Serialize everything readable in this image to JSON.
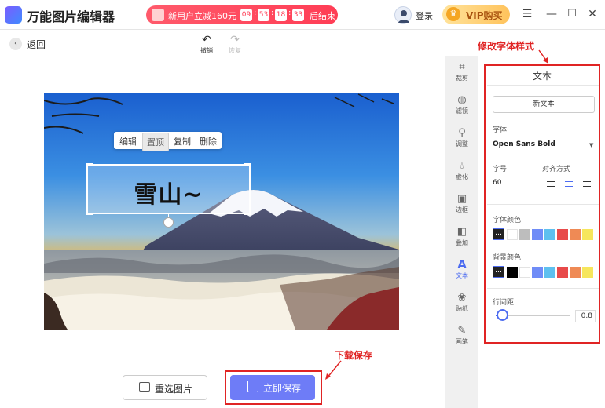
{
  "app": {
    "title": "万能图片编辑器"
  },
  "promo": {
    "text": "新用户立减160元",
    "timer": [
      "09",
      "53",
      "18",
      "33"
    ],
    "end_label": "后结束"
  },
  "header": {
    "login_label": "登录",
    "vip_label": "VIP购买",
    "crown_icon": "crown-icon",
    "menu_icon": "hamburger-icon",
    "minimize_icon": "minimize-icon",
    "maximize_icon": "maximize-icon",
    "close_icon": "close-icon"
  },
  "nav": {
    "back_label": "返回",
    "undo_label": "撤销",
    "redo_label": "恢复"
  },
  "context_menu": [
    "编辑",
    "置顶",
    "复制",
    "删除"
  ],
  "text_layer": {
    "content": "雪山~"
  },
  "buttons": {
    "reselect_label": "重选图片",
    "save_label": "立即保存"
  },
  "annotations": {
    "download_save": "下载保存",
    "modify_font_style": "修改字体样式"
  },
  "toolbar": [
    {
      "label": "裁剪",
      "icon": "crop-icon",
      "active": false
    },
    {
      "label": "滤镜",
      "icon": "filter-icon",
      "active": false
    },
    {
      "label": "调整",
      "icon": "adjust-icon",
      "active": false
    },
    {
      "label": "虚化",
      "icon": "blur-icon",
      "active": false
    },
    {
      "label": "边框",
      "icon": "border-icon",
      "active": false
    },
    {
      "label": "叠加",
      "icon": "overlay-icon",
      "active": false
    },
    {
      "label": "文本",
      "icon": "text-icon",
      "active": true
    },
    {
      "label": "贴纸",
      "icon": "sticker-icon",
      "active": false
    },
    {
      "label": "画笔",
      "icon": "brush-icon",
      "active": false
    }
  ],
  "panel": {
    "title": "文本",
    "new_text_label": "新文本",
    "font_label": "字体",
    "font_value": "Open Sans Bold",
    "size_label": "字号",
    "size_value": "60",
    "align_label": "对齐方式",
    "alignment": "center",
    "font_color_label": "字体颜色",
    "font_colors": [
      "#ffffff",
      "#bdbdbd",
      "#6f8cf7",
      "#5ec0ef",
      "#e84a4a",
      "#ef8a55",
      "#f6e65c"
    ],
    "bg_color_label": "背景颜色",
    "bg_colors": [
      "#000000",
      "#ffffff",
      "#6f8cf7",
      "#5ec0ef",
      "#e84a4a",
      "#ef8a55",
      "#f6e65c"
    ],
    "line_spacing_label": "行间距",
    "line_spacing_value": "0.8",
    "line_spacing_fraction": 0.08
  }
}
